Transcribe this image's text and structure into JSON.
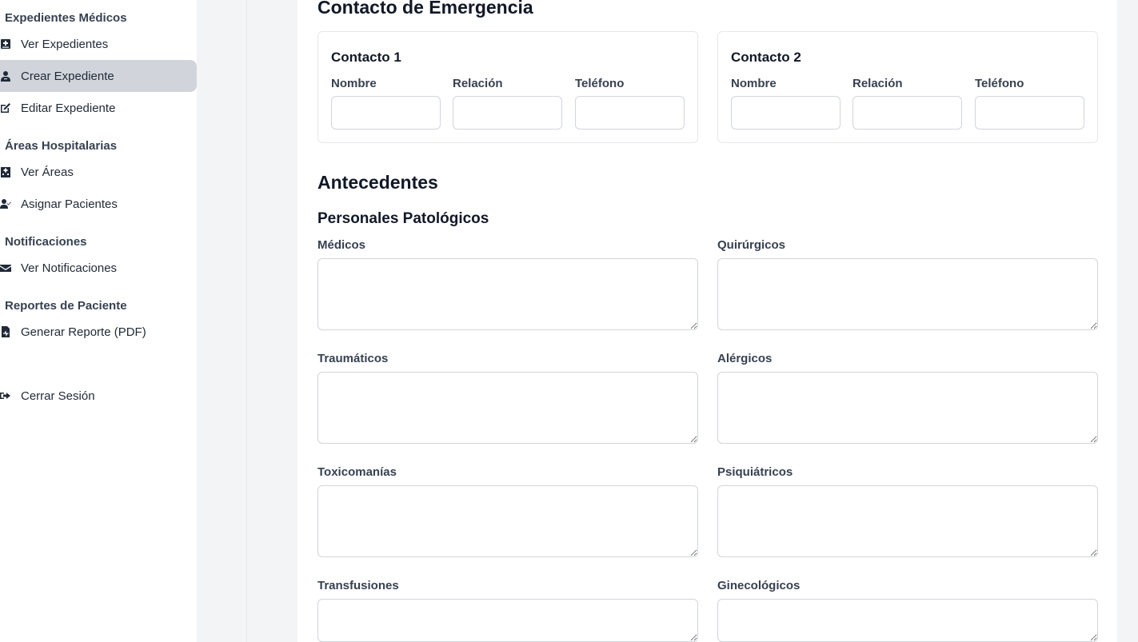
{
  "sidebar": {
    "sections": [
      {
        "title": "Expedientes Médicos",
        "items": [
          {
            "label": "Ver Expedientes",
            "icon": "file-medical-icon"
          },
          {
            "label": "Crear Expediente",
            "icon": "user-doctor-icon",
            "active": true
          },
          {
            "label": "Editar Expediente",
            "icon": "edit-icon"
          }
        ]
      },
      {
        "title": "Áreas Hospitalarias",
        "items": [
          {
            "label": "Ver Áreas",
            "icon": "hospital-icon"
          },
          {
            "label": "Asignar Pacientes",
            "icon": "user-check-icon"
          }
        ]
      },
      {
        "title": "Notificaciones",
        "items": [
          {
            "label": "Ver Notificaciones",
            "icon": "envelope-icon"
          }
        ]
      },
      {
        "title": "Reportes de Paciente",
        "items": [
          {
            "label": "Generar Reporte (PDF)",
            "icon": "file-pdf-icon"
          }
        ]
      }
    ],
    "logout": {
      "label": "Cerrar Sesión",
      "icon": "sign-out-icon"
    }
  },
  "form": {
    "emergency_title": "Contacto de Emergencia",
    "contacts": [
      {
        "title": "Contacto 1",
        "labels": [
          "Nombre",
          "Relación",
          "Teléfono"
        ]
      },
      {
        "title": "Contacto 2",
        "labels": [
          "Nombre",
          "Relación",
          "Teléfono"
        ]
      }
    ],
    "antecedentes_title": "Antecedentes",
    "personales_title": "Personales Patológicos",
    "fields": [
      "Médicos",
      "Quirúrgicos",
      "Traumáticos",
      "Alérgicos",
      "Toxicomanías",
      "Psiquiátricos",
      "Transfusiones",
      "Ginecológicos"
    ]
  },
  "colors": {
    "active_nav_bg": "#d1d5db",
    "page_bg": "#f3f4f6",
    "border": "#d1d5db"
  }
}
